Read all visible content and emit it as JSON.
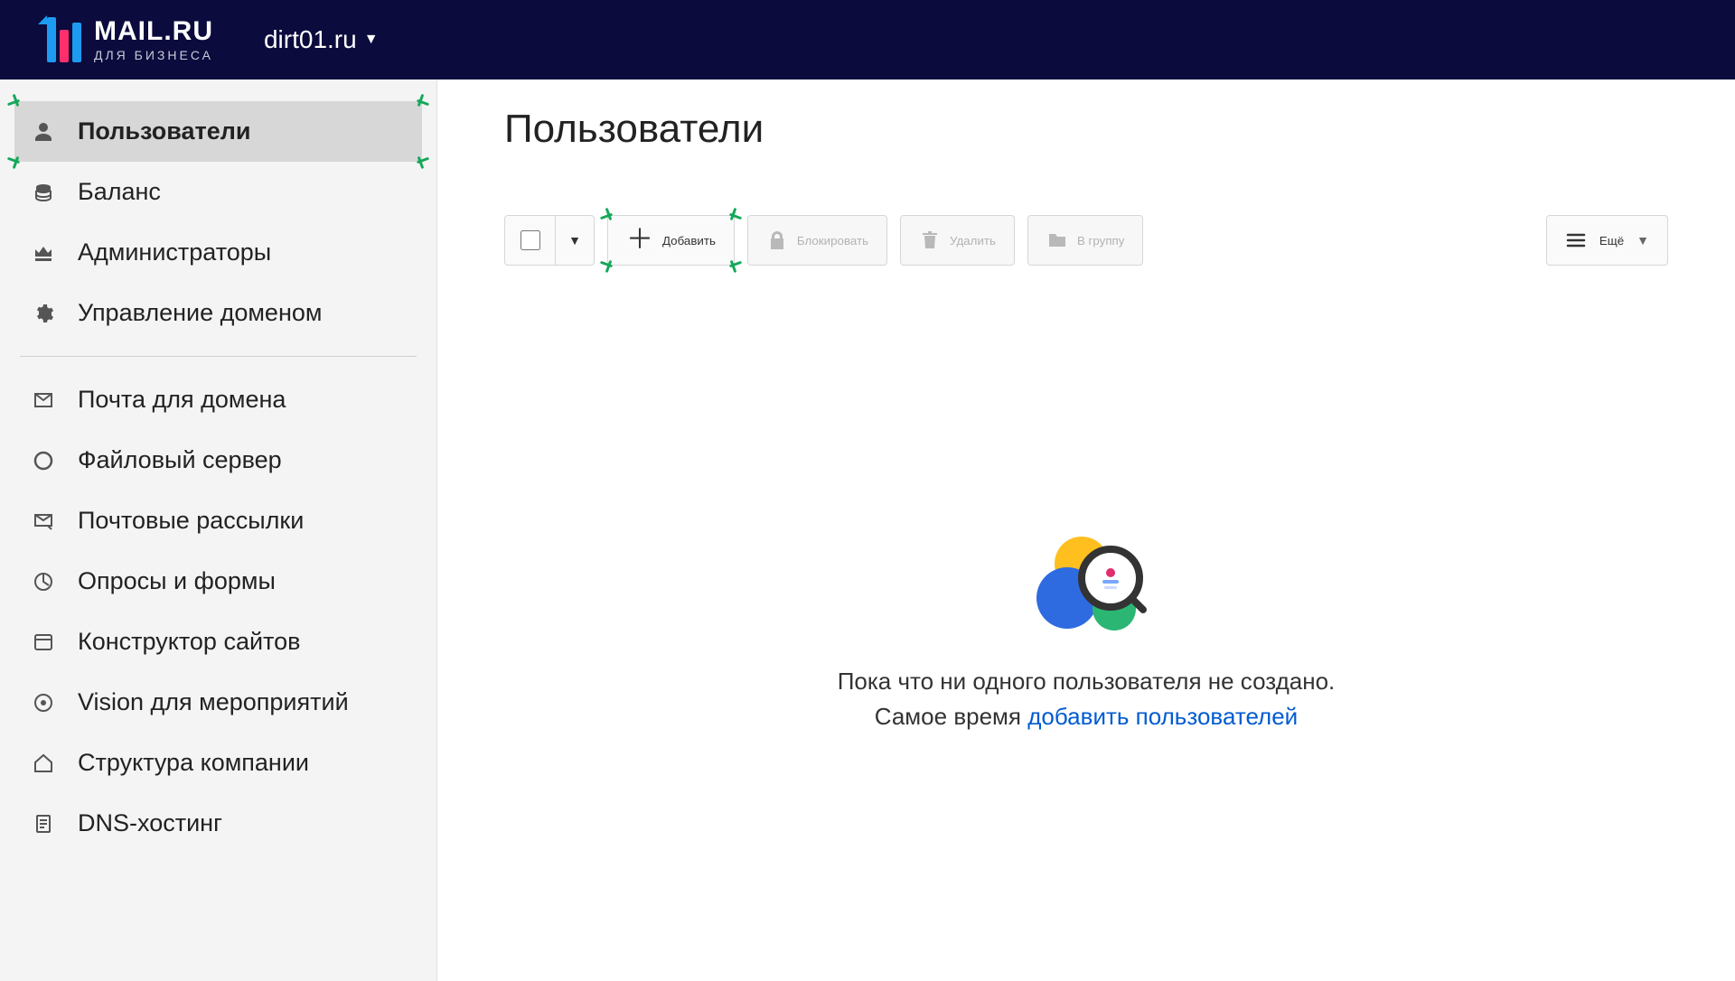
{
  "header": {
    "logo_line1": "MAIL.RU",
    "logo_line2": "ДЛЯ БИЗНЕСА",
    "domain": "dirt01.ru"
  },
  "sidebar": {
    "items": [
      {
        "label": "Пользователи",
        "icon": "user-icon",
        "active": true
      },
      {
        "label": "Баланс",
        "icon": "balance-icon"
      },
      {
        "label": "Администраторы",
        "icon": "admins-icon"
      },
      {
        "label": "Управление доменом",
        "icon": "domain-settings-icon"
      }
    ],
    "items2": [
      {
        "label": "Почта для домена",
        "icon": "mail-icon"
      },
      {
        "label": "Файловый сервер",
        "icon": "fileserver-icon"
      },
      {
        "label": "Почтовые рассылки",
        "icon": "mailings-icon"
      },
      {
        "label": "Опросы и формы",
        "icon": "polls-icon"
      },
      {
        "label": "Конструктор сайтов",
        "icon": "sitebuilder-icon"
      },
      {
        "label": "Vision для мероприятий",
        "icon": "vision-icon"
      },
      {
        "label": "Структура компании",
        "icon": "company-structure-icon"
      },
      {
        "label": "DNS-хостинг",
        "icon": "dns-hosting-icon"
      }
    ]
  },
  "main": {
    "title": "Пользователи",
    "toolbar": {
      "add": "Добавить",
      "block": "Блокировать",
      "delete": "Удалить",
      "to_group": "В группу",
      "more": "Ещё"
    },
    "empty": {
      "line1": "Пока что ни одного пользователя не создано.",
      "line2_prefix": "Самое время ",
      "line2_link": "добавить пользователей"
    }
  }
}
